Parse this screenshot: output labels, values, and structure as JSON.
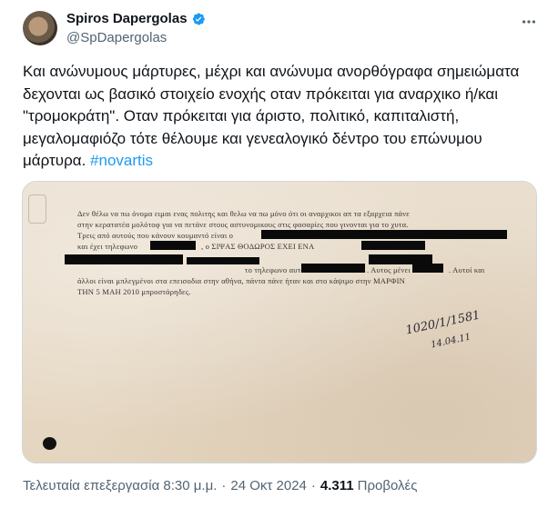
{
  "author": {
    "display_name": "Spiros Dapergolas",
    "handle": "@SpDapergolas"
  },
  "tweet": {
    "text": "Και ανώνυμους μάρτυρες, μέχρι και ανώνυμα ανορθόγραφα σημειώματα δεχονται ως βασικό στοιχείο ενοχής οταν πρόκειται για αναρχικο ή/και \"τρομοκράτη\". Οταν πρόκειται για άριστο, πολιτικό, καπιταλιστή, μεγαλομαφιόζο τότε θέλουμε και γενεαλογικό δέντρο του επώνυμου μάρτυρα.",
    "hashtag": "#novartis"
  },
  "document": {
    "lines": [
      "Δεν θέλω να πω όνομα ειμαι ενας πολιτης και θελω να πω μόνο ότι οι αναρχικοι απ τα εξαρχεια πάνε",
      "στην κερατατέα μολότοφ για να πετάνε στους αστυνομικους στις φασαρίες που γινονται για το χυτα.",
      "Τρεις από αυτούς που κάνουν κουμαντό είναι ο",
      "και έχει τηλεφωνο",
      ", ο ΣΙΨΑΣ ΘΟΔΩΡΟΣ ΕΧΕΙ ΕΝΑ",
      "το τηλεφωνο αυτού είναι",
      ". Αυτος μένει",
      ". Αυτοί και",
      "άλλοι είναι μπλεγμένοι στα επεισοδια στην αθήνα, πάντα πάνε ήταν και στο κάψιμο στην ΜΑΡΦΙΝ",
      "ΤΗΝ 5 ΜΑΗ 2010 μπροστάρηδες."
    ],
    "handwriting_main": "1020/1/1581",
    "handwriting_date": "14.04.11"
  },
  "footer": {
    "edited_label": "Τελευταία επεξεργασία 8:30 μ.μ.",
    "separator": "·",
    "date": "24 Οκτ 2024",
    "views_count": "4.311",
    "views_label": "Προβολές"
  },
  "colors": {
    "accent": "#1d9bf0",
    "text_primary": "#0f1419",
    "text_secondary": "#536471"
  }
}
